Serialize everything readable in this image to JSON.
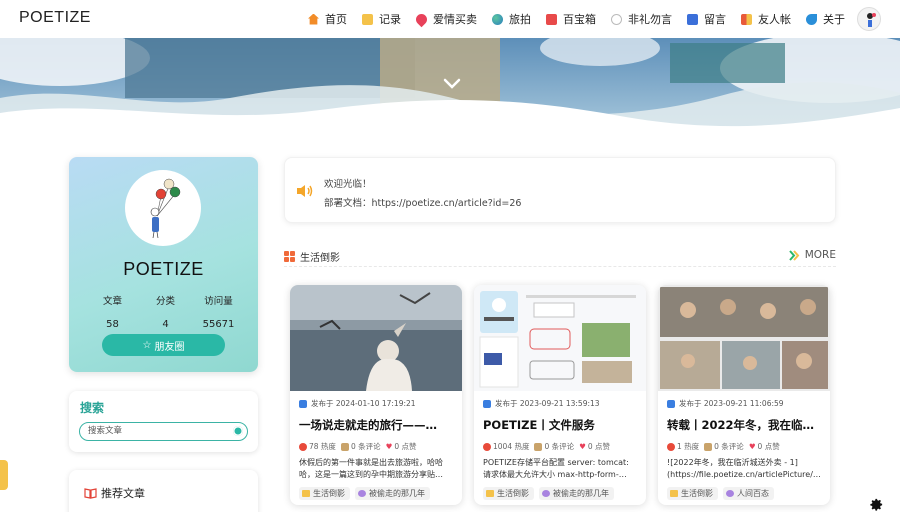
{
  "nav": {
    "logo": "POETIZE",
    "items": [
      {
        "label": "首页",
        "icon": "home-icon",
        "color": "#f28c28"
      },
      {
        "label": "记录",
        "icon": "notebook-icon",
        "color": "#f4c24a"
      },
      {
        "label": "爱情买卖",
        "icon": "heart-icon",
        "color": "#e8415a"
      },
      {
        "label": "旅拍",
        "icon": "globe-icon",
        "color": "#2a9d8f"
      },
      {
        "label": "百宝箱",
        "icon": "toolbox-icon",
        "color": "#e84a4a"
      },
      {
        "label": "非礼勿言",
        "icon": "speech-bubble-icon",
        "color": "#cccccc"
      },
      {
        "label": "留言",
        "icon": "message-icon",
        "color": "#3b6fd9"
      },
      {
        "label": "友人帐",
        "icon": "friends-icon",
        "color": "#e85a3a"
      },
      {
        "label": "关于",
        "icon": "bird-icon",
        "color": "#2a8fd9"
      }
    ]
  },
  "profile": {
    "name": "POETIZE",
    "stats": [
      {
        "label": "文章",
        "value": "58"
      },
      {
        "label": "分类",
        "value": "4"
      },
      {
        "label": "访问量",
        "value": "55671"
      }
    ],
    "friends_button": "朋友圈"
  },
  "search": {
    "title": "搜索",
    "placeholder": "搜索文章"
  },
  "recommend": {
    "title": "推荐文章"
  },
  "notice": {
    "line1": "欢迎光临！",
    "line2": "部署文档：https://poetize.cn/article?id=26"
  },
  "section": {
    "title": "生活倒影",
    "more": "MORE"
  },
  "articles": [
    {
      "date": "发布于 2024-01-10 17:19:21",
      "title": "一场说走就走的旅行——…",
      "heat": "78 热度",
      "comments": "0 条评论",
      "likes": "0 点赞",
      "excerpt": "休假后的第一件事就是出去旅游啦，哈哈哈，这是一篇这到的孕中期旅游分享贴…",
      "tags": [
        "生活倒影",
        "被偷走的那几年"
      ]
    },
    {
      "date": "发布于 2023-09-21 13:59:13",
      "title": "POETIZE丨文件服务",
      "heat": "1004 热度",
      "comments": "0 条评论",
      "likes": "0 点赞",
      "excerpt": "POETIZE存储平台配置 server: tomcat: 请求体最大允许大小 max-http-form-…",
      "tags": [
        "生活倒影",
        "被偷走的那几年"
      ]
    },
    {
      "date": "发布于 2023-09-21 11:06:59",
      "title": "转载丨2022年冬，我在临…",
      "heat": "1 热度",
      "comments": "0 条评论",
      "likes": "0 点赞",
      "excerpt": "![2022年冬，我在临沂城送外卖 - 1](https://file.poetize.cn/articlePicture/…",
      "tags": [
        "生活倒影",
        "人间百态"
      ]
    }
  ],
  "colors": {
    "accent": "#2ab8a6",
    "search_title": "#28a396",
    "section_icon": "#f06a3a"
  }
}
